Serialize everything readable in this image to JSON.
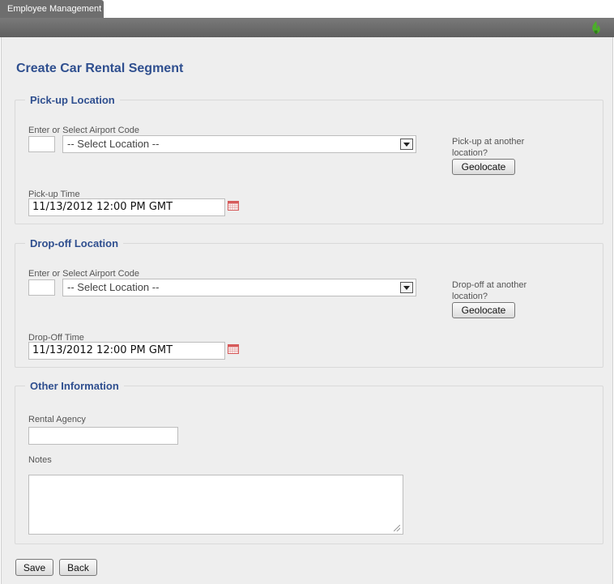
{
  "app": {
    "tab_label": "Employee Management",
    "logo_icon": "flame-logo-icon"
  },
  "page": {
    "title": "Create Car Rental Segment"
  },
  "pickup": {
    "legend": "Pick-up Location",
    "airport_label": "Enter or Select Airport Code",
    "airport_code_value": "",
    "location_select_value": "-- Select Location --",
    "other_location_text": "Pick-up at another location?",
    "geolocate_label": "Geolocate",
    "time_label": "Pick-up Time",
    "time_value": "11/13/2012 12:00 PM GMT"
  },
  "dropoff": {
    "legend": "Drop-off Location",
    "airport_label": "Enter or Select Airport Code",
    "airport_code_value": "",
    "location_select_value": "-- Select Location --",
    "other_location_text": "Drop-off at another location?",
    "geolocate_label": "Geolocate",
    "time_label": "Drop-Off Time",
    "time_value": "11/13/2012 12:00 PM GMT"
  },
  "other": {
    "legend": "Other Information",
    "agency_label": "Rental Agency",
    "agency_value": "",
    "notes_label": "Notes",
    "notes_value": ""
  },
  "actions": {
    "save_label": "Save",
    "back_label": "Back"
  },
  "colors": {
    "accent": "#2f4f8f",
    "topbar": "#6e6e6e",
    "background": "#eeeeee"
  }
}
